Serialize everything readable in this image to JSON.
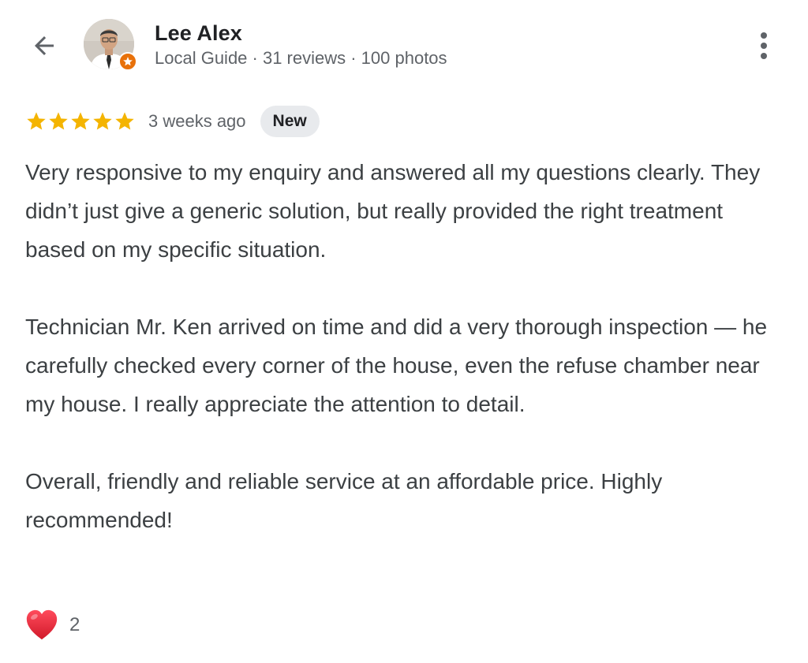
{
  "header": {
    "back_icon": "arrow-left-icon",
    "reviewer_name": "Lee Alex",
    "reviewer_meta": "Local Guide · 31 reviews · 100 photos",
    "more_icon": "more-vert-icon"
  },
  "review": {
    "rating": 5,
    "rating_max": 5,
    "time": "3 weeks ago",
    "badge": "New",
    "paragraphs": [
      "Very responsive to my enquiry and answered all my questions clearly. They didn’t just give a generic solution, but really provided the right treatment based on my specific situation.",
      "Technician Mr. Ken arrived on time and did a very thorough inspection — he carefully checked every corner of the house, even the refuse chamber near my house. I really appreciate the attention to detail.",
      "Overall, friendly and reliable service at an affordable price. Highly recommended!"
    ]
  },
  "reactions": {
    "icon": "heart-icon",
    "count": "2"
  },
  "colors": {
    "star": "#f4b400",
    "guide_badge": "#e8710a",
    "heart": "#e0243a",
    "badge_bg": "#e8eaed"
  }
}
